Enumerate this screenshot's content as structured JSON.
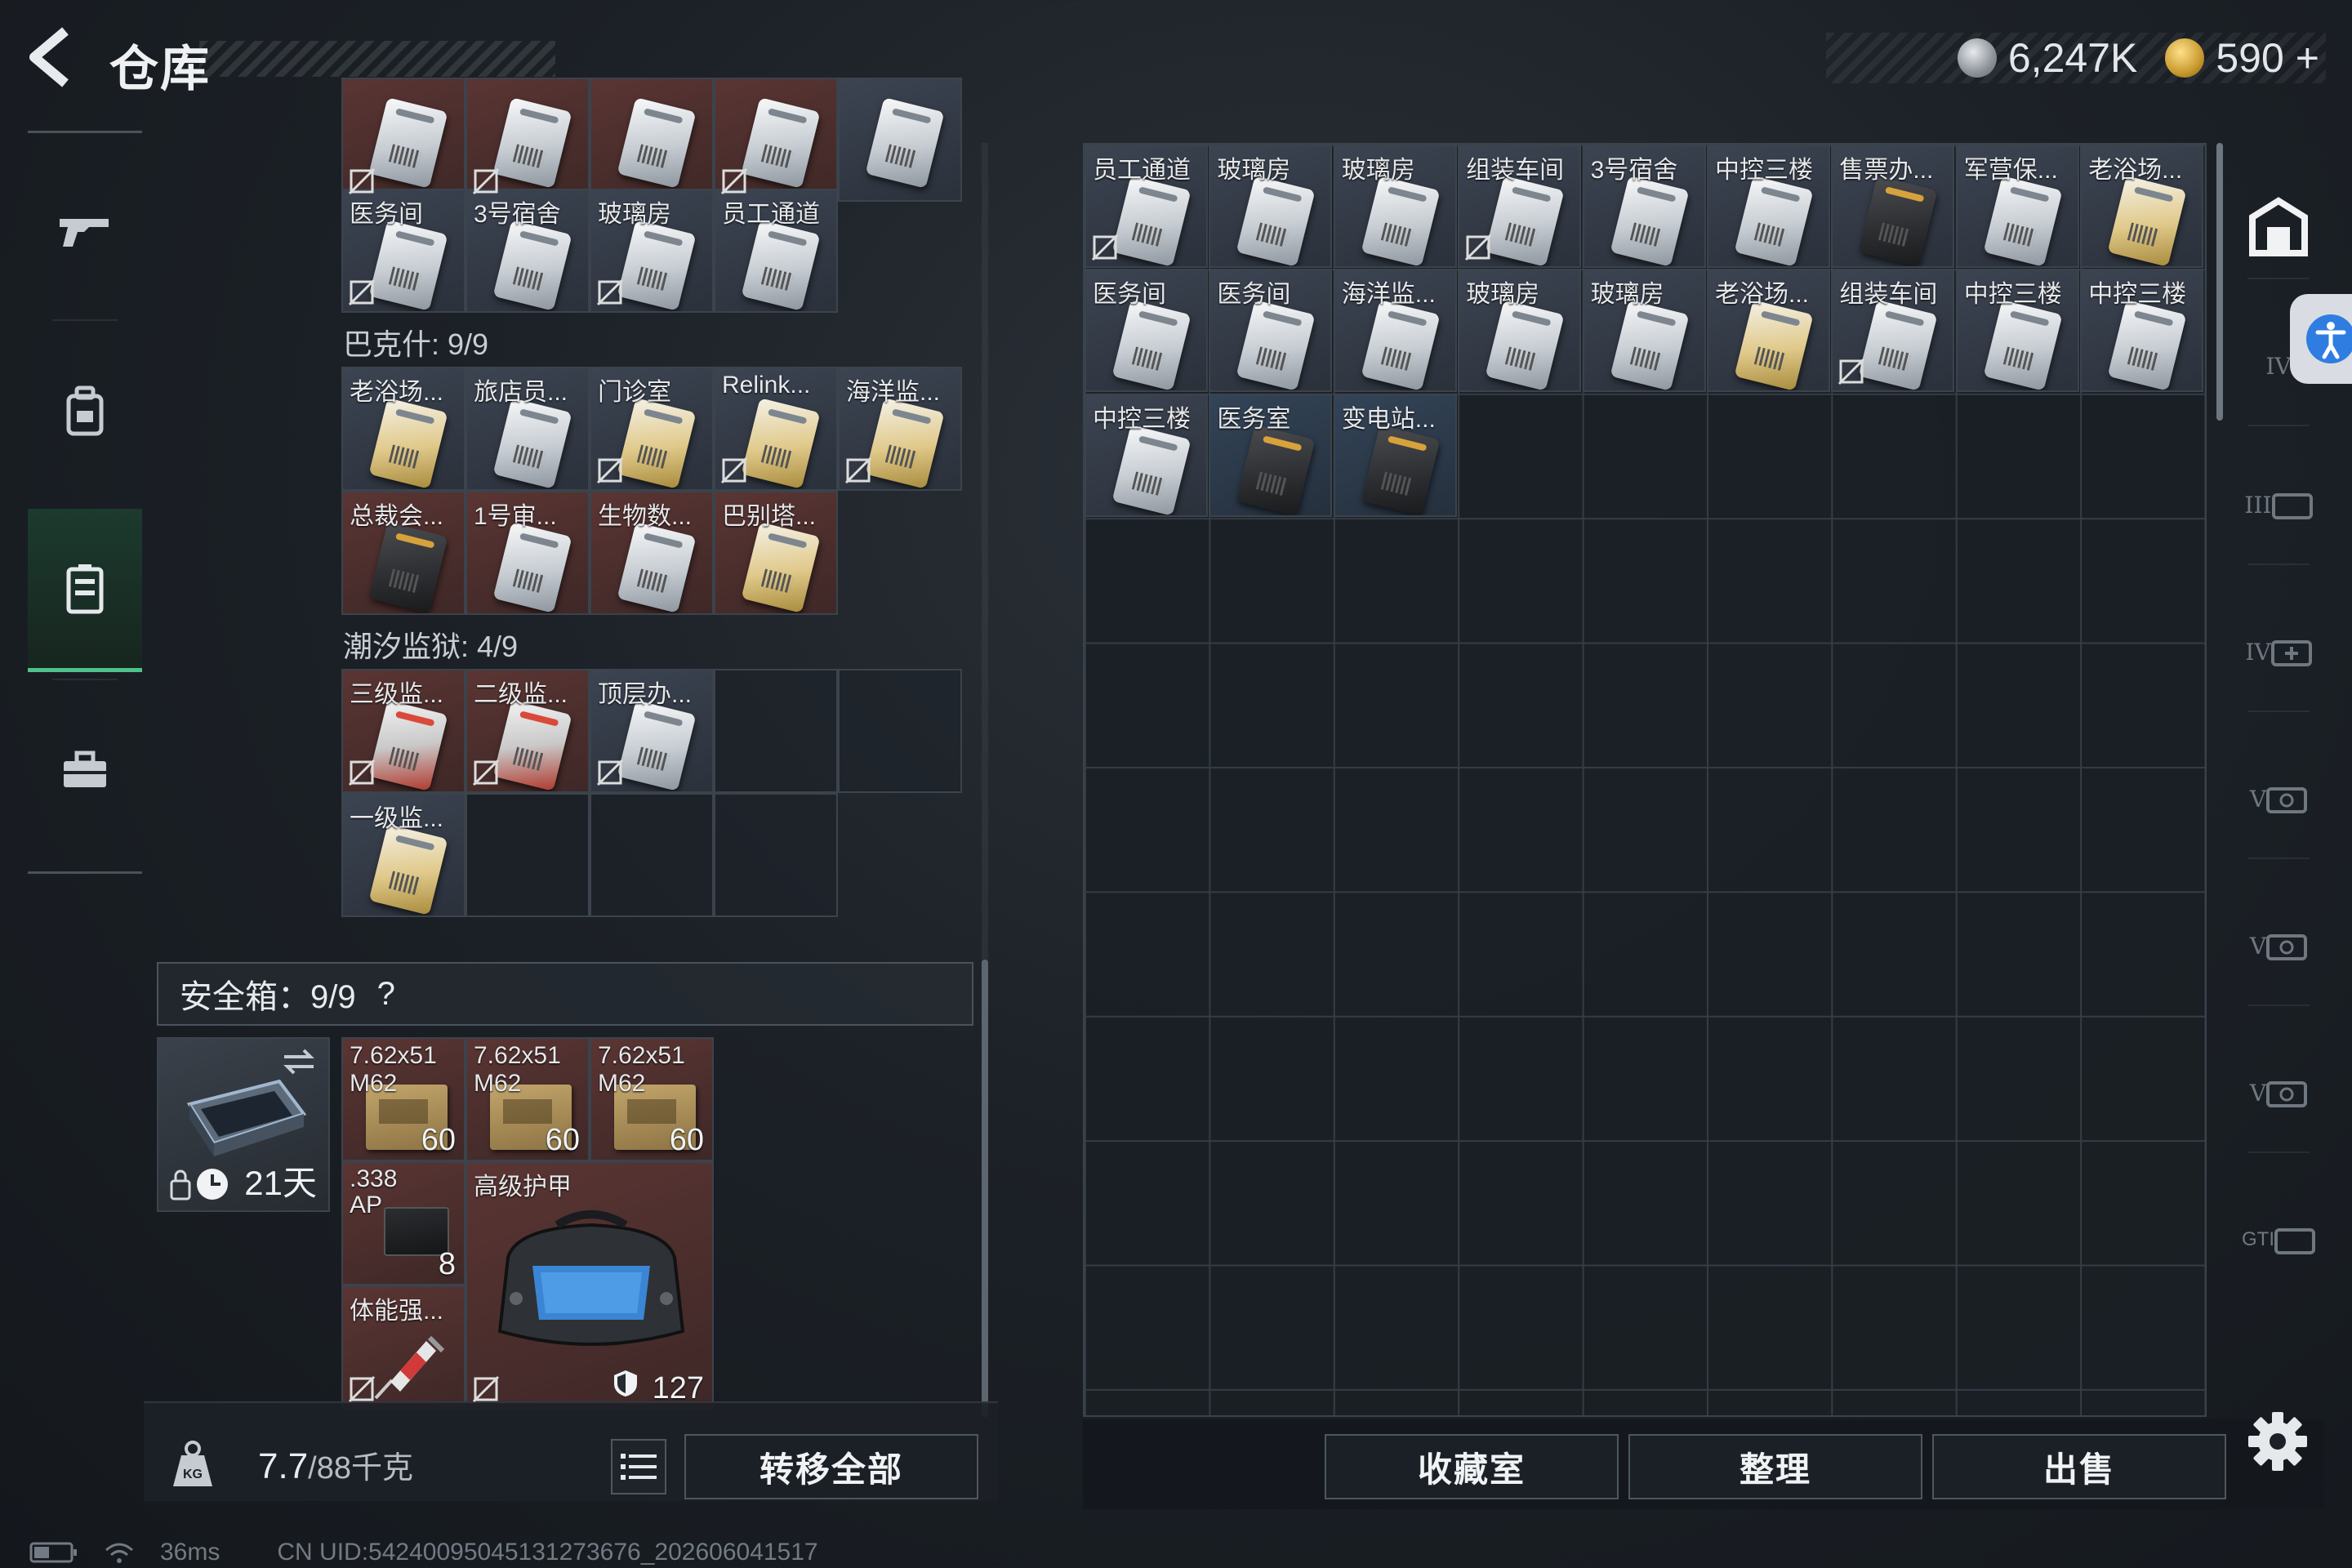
{
  "header": {
    "title": "仓库",
    "currency_silver": "6,247K",
    "currency_gold": "590",
    "currency_gold_add": "+"
  },
  "left_rail": {
    "items": [
      {
        "icon": "gun-icon"
      },
      {
        "icon": "backpack-icon"
      },
      {
        "icon": "keycard-holder-icon",
        "active": true
      },
      {
        "icon": "briefcase-icon"
      }
    ]
  },
  "key_section_top": {
    "row_partial": [
      "",
      "",
      "",
      "",
      ""
    ],
    "row2": [
      "医务间",
      "3号宿舍",
      "玻璃房",
      "员工通道"
    ]
  },
  "baksh": {
    "title": "巴克什: 9/9",
    "row1": [
      "老浴场...",
      "旅店员...",
      "门诊室",
      "Relink...",
      "海洋监..."
    ],
    "row2": [
      "总裁会...",
      "1号审...",
      "生物数...",
      "巴别塔..."
    ]
  },
  "tide_prison": {
    "title": "潮汐监狱: 4/9",
    "row1": [
      "三级监...",
      "二级监...",
      "顶层办..."
    ],
    "row2": [
      "一级监..."
    ]
  },
  "safe_box": {
    "title": "安全箱：9/9",
    "help": "?",
    "days": "21天",
    "items": {
      "ammo1": {
        "label": "7.62x51 M62",
        "count": "60"
      },
      "ammo2": {
        "label": "7.62x51 M62",
        "count": "60"
      },
      "ammo3": {
        "label": "7.62x51 M62",
        "count": "60"
      },
      "sniper": {
        "label": ".338 AP",
        "count": "8"
      },
      "armor": {
        "label": "高级护甲",
        "durability": "127"
      },
      "stim": {
        "label": "体能强..."
      }
    }
  },
  "weight": {
    "current": "7.7",
    "max_unit": "/88千克"
  },
  "actions": {
    "transfer_all": "转移全部",
    "collection": "收藏室",
    "organize": "整理",
    "sell": "出售"
  },
  "stash": {
    "row1": [
      "员工通道",
      "玻璃房",
      "玻璃房",
      "组装车间",
      "3号宿舍",
      "中控三楼",
      "售票办...",
      "军营保...",
      "老浴场..."
    ],
    "row2": [
      "医务间",
      "医务间",
      "海洋监...",
      "玻璃房",
      "玻璃房",
      "老浴场...",
      "组装车间",
      "中控三楼",
      "中控三楼"
    ],
    "row3": [
      "中控三楼",
      "医务室",
      "变电站..."
    ]
  },
  "right_rail": {
    "tier_labels": [
      "IV",
      "III",
      "IV",
      "V",
      "V",
      "V",
      "GTI"
    ]
  },
  "status": {
    "ping": "36ms",
    "uid": "CN UID:54240095045131273676_202606041517"
  },
  "colors": {
    "accent_green": "#4ec28a",
    "rarity_red": "#5a3533",
    "rarity_slate": "#3c4452",
    "access_blue": "#2f7de1"
  }
}
